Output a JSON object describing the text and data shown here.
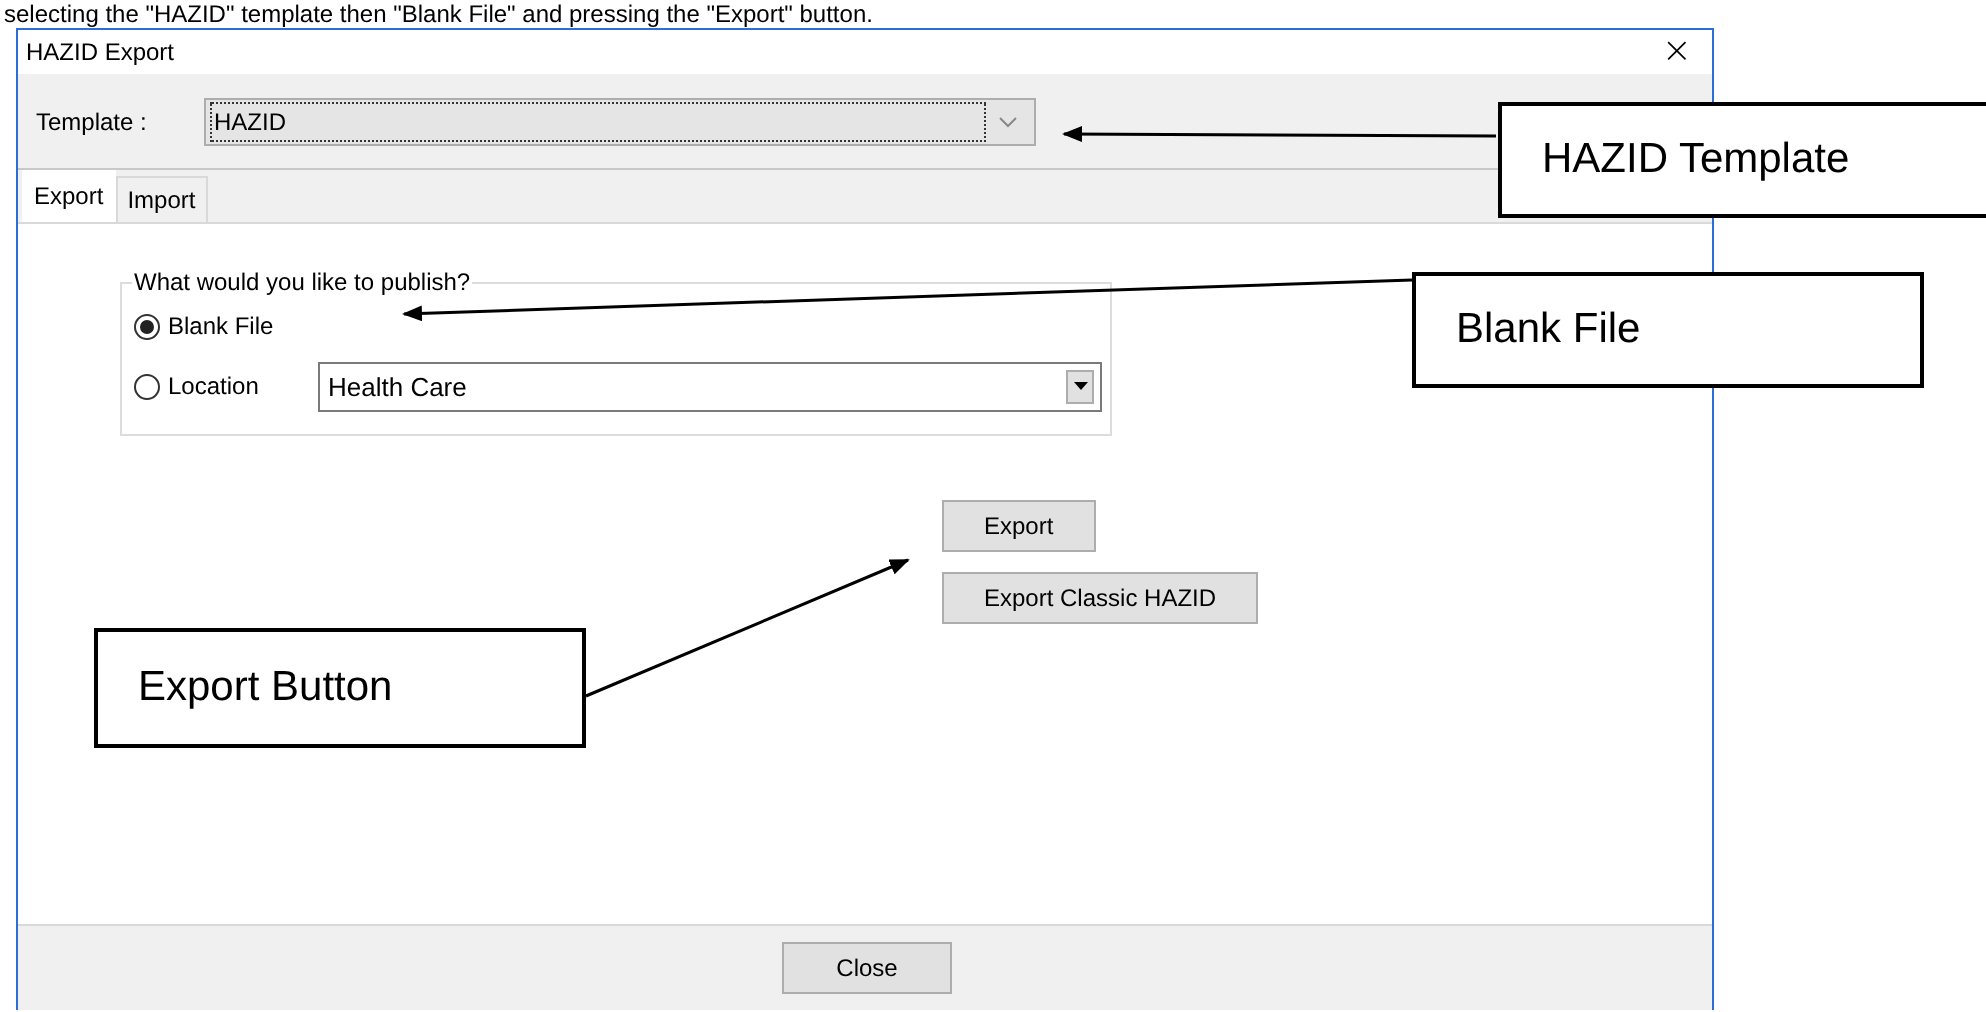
{
  "caption": "selecting the \"HAZID\" template then \"Blank File\" and pressing the \"Export\" button.",
  "window": {
    "title": "HAZID Export",
    "close": "×"
  },
  "template": {
    "label": "Template :",
    "value": "HAZID"
  },
  "tabs": [
    {
      "label": "Export",
      "selected": true
    },
    {
      "label": "Import",
      "selected": false
    }
  ],
  "publish_group": {
    "legend": "What would you like to publish?",
    "options": [
      {
        "label": "Blank File",
        "selected": true
      },
      {
        "label": "Location",
        "selected": false
      }
    ],
    "location": {
      "value": "Health Care"
    }
  },
  "buttons": [
    "Export",
    "Export Classic HAZID"
  ],
  "footer_button": "Close",
  "callouts": [
    {
      "text": "HAZID Template"
    },
    {
      "text": "Blank File"
    },
    {
      "text": "Export Button"
    }
  ]
}
